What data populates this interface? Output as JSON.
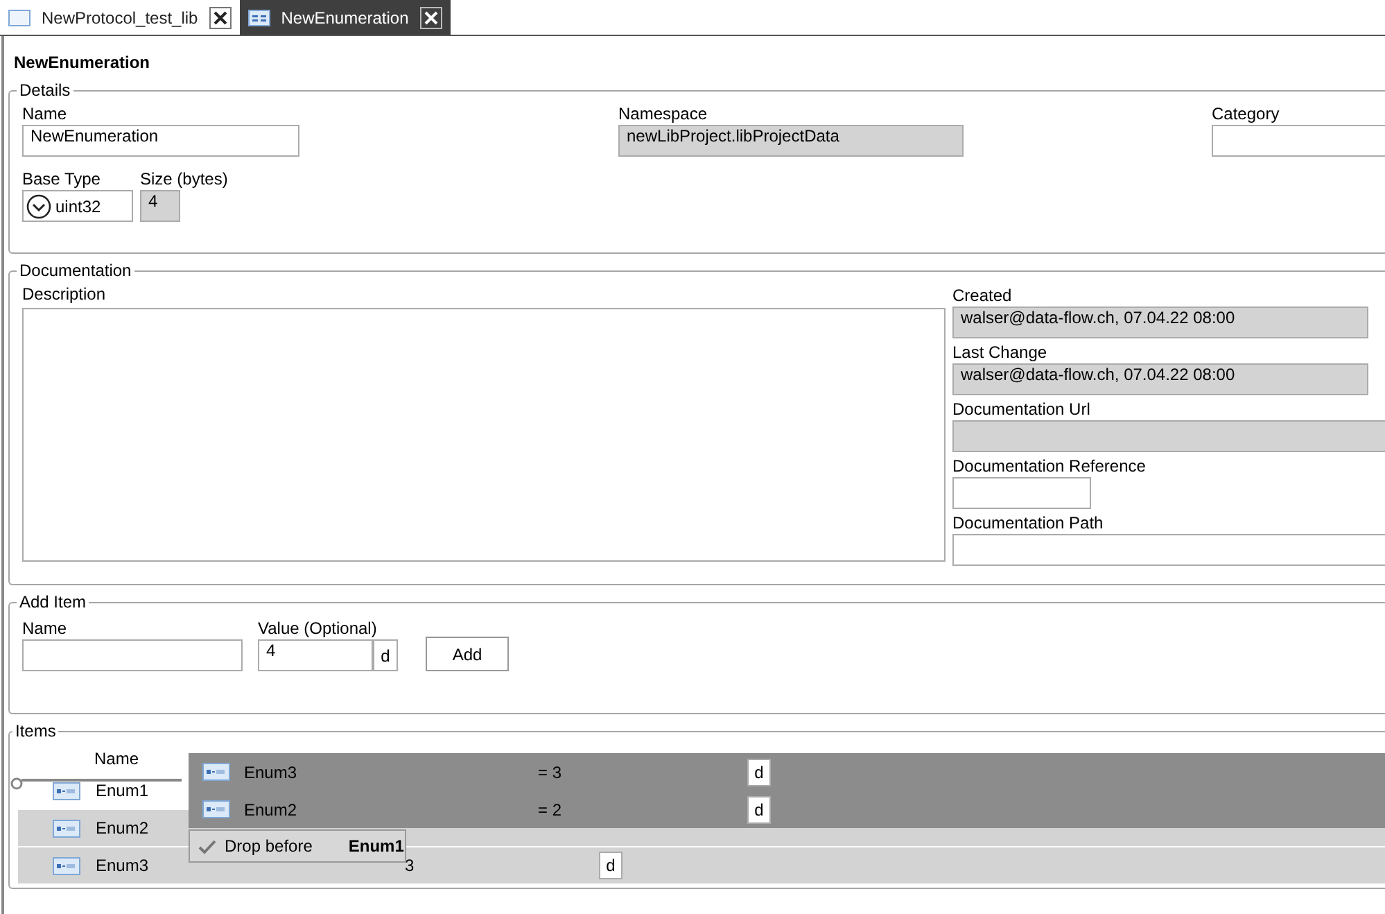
{
  "tabs": [
    {
      "label": "NewProtocol_test_lib",
      "selected": false
    },
    {
      "label": "NewEnumeration",
      "selected": true
    }
  ],
  "title": "NewEnumeration",
  "details": {
    "legend": "Details",
    "name": {
      "label": "Name",
      "value": "NewEnumeration",
      "disabled": false
    },
    "namespace": {
      "label": "Namespace",
      "value": "newLibProject.libProjectData",
      "disabled": true
    },
    "category": {
      "label": "Category",
      "disabled": false
    },
    "base_type": {
      "label": "Base Type",
      "value": "uint32"
    },
    "size": {
      "label": "Size (bytes)",
      "value": "4",
      "disabled": true
    }
  },
  "documentation": {
    "legend": "Documentation",
    "description": {
      "label": "Description"
    },
    "fields": [
      {
        "label": "Created",
        "value": "walser@data-flow.ch, 07.04.22 08:00",
        "disabled": true,
        "kind": "wide"
      },
      {
        "label": "Last Change",
        "value": "walser@data-flow.ch, 07.04.22 08:00",
        "disabled": true,
        "kind": "wide"
      },
      {
        "label": "Documentation Url",
        "disabled": true,
        "kind": "full"
      },
      {
        "label": "Documentation Reference",
        "disabled": false,
        "kind": "short"
      },
      {
        "label": "Documentation Path",
        "disabled": false,
        "kind": "full"
      }
    ]
  },
  "add_item": {
    "legend": "Add Item",
    "name": {
      "label": "Name"
    },
    "value": {
      "label": "Value (Optional)",
      "value": "4",
      "format": "d"
    },
    "button": "Add"
  },
  "items": {
    "legend": "Items",
    "columns": [
      "Name"
    ],
    "rows": [
      {
        "name": "Enum1",
        "selected": false
      },
      {
        "name": "Enum2",
        "selected": true
      },
      {
        "name": "Enum3",
        "value": "3",
        "format": "d",
        "selected": true
      }
    ],
    "drag_preview": [
      {
        "name": "Enum3",
        "value": "= 3",
        "format": "d"
      },
      {
        "name": "Enum2",
        "value": "= 2",
        "format": "d"
      }
    ],
    "drop_hint": {
      "text": "Drop before",
      "target": "Enum1"
    }
  }
}
